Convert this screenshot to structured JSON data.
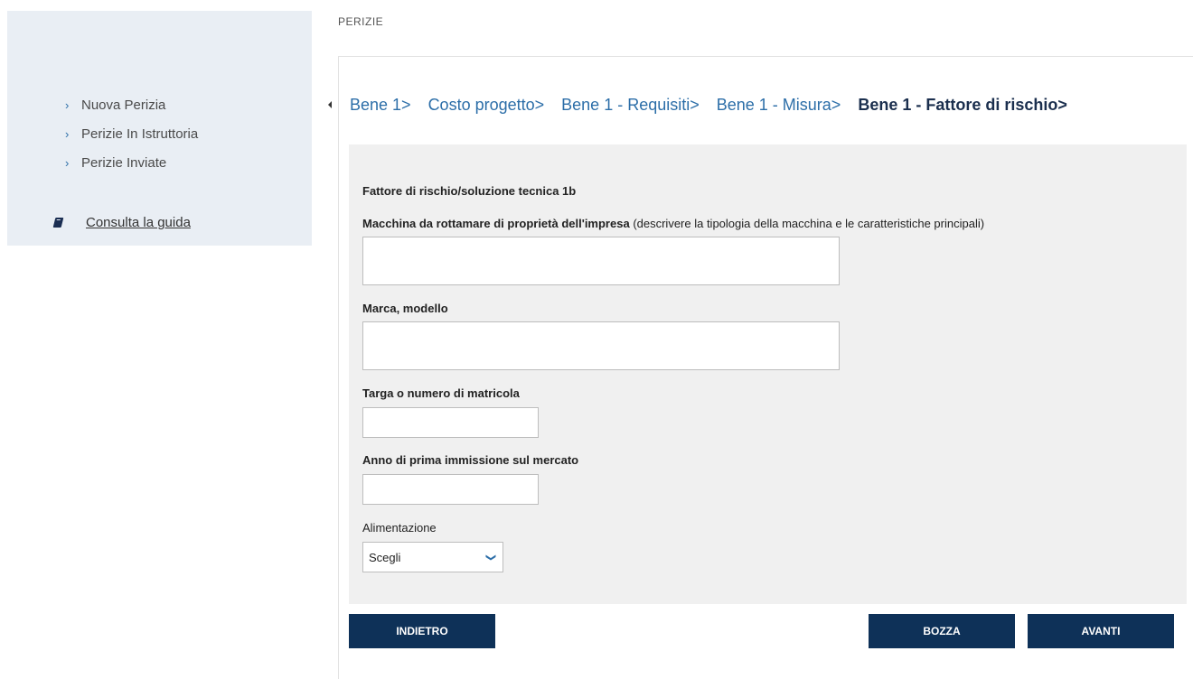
{
  "sidebar": {
    "items": [
      {
        "label": "Nuova Perizia"
      },
      {
        "label": "Perizie In Istruttoria"
      },
      {
        "label": "Perizie Inviate"
      }
    ],
    "guide_label": "Consulta la guida"
  },
  "header": {
    "title": "PERIZIE"
  },
  "steps": [
    {
      "label": "Bene 1>",
      "active": false
    },
    {
      "label": "Costo progetto>",
      "active": false
    },
    {
      "label": "Bene 1 - Requisiti>",
      "active": false
    },
    {
      "label": "Bene 1 - Misura>",
      "active": false
    },
    {
      "label": "Bene 1 - Fattore di rischio>",
      "active": true
    }
  ],
  "form": {
    "section_title": "Fattore di rischio/soluzione tecnica 1b",
    "machine_label": "Macchina da rottamare di proprietà dell'impresa",
    "machine_note": "(descrivere la tipologia della macchina e le caratteristiche principali)",
    "machine_value": "",
    "brand_label": "Marca, modello",
    "brand_value": "",
    "plate_label": "Targa o numero di matricola",
    "plate_value": "",
    "year_label": "Anno di prima immissione sul mercato",
    "year_value": "",
    "fuel_label": "Alimentazione",
    "fuel_selected": "Scegli"
  },
  "buttons": {
    "back": "INDIETRO",
    "draft": "BOZZA",
    "next": "AVANTI"
  },
  "colors": {
    "primary": "#0e3158",
    "link": "#2c6ea8",
    "sidebar_bg": "#e9eef4",
    "panel_bg": "#f0f0f0"
  }
}
